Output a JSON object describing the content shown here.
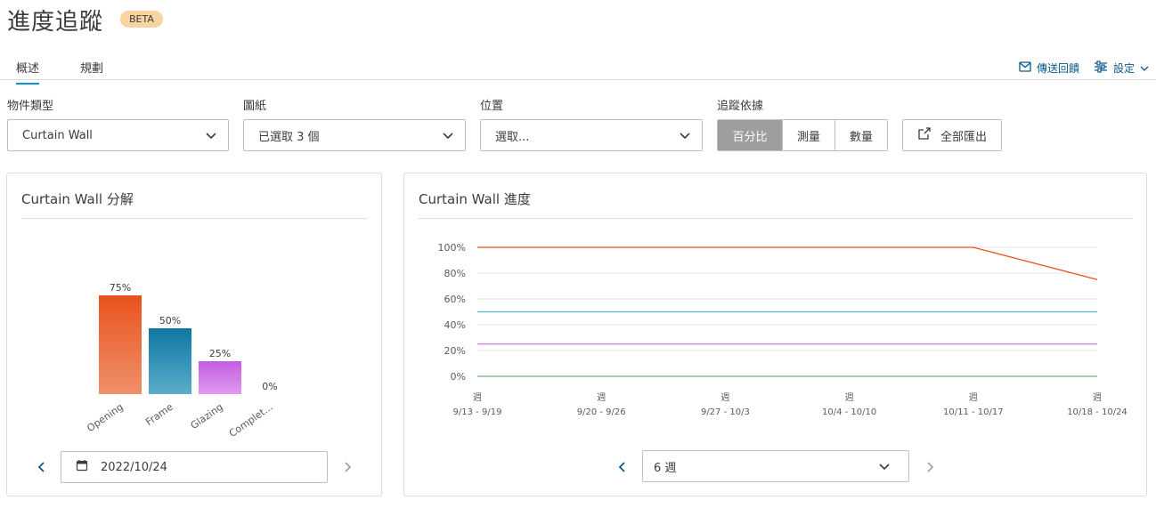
{
  "header": {
    "title": "進度追蹤",
    "badge": "BETA"
  },
  "tabs": [
    {
      "label": "概述",
      "active": true
    },
    {
      "label": "規劃",
      "active": false
    }
  ],
  "top_links": {
    "feedback": "傳送回饋",
    "settings": "設定"
  },
  "filters": {
    "object_type": {
      "label": "物件類型",
      "value": "Curtain Wall"
    },
    "drawings": {
      "label": "圖紙",
      "value": "已選取 3 個"
    },
    "location": {
      "label": "位置",
      "placeholder": "選取..."
    },
    "track_by": {
      "label": "追蹤依據",
      "options": [
        "百分比",
        "測量",
        "數量"
      ],
      "selected": "百分比"
    },
    "export_all": "全部匯出"
  },
  "breakdown_panel": {
    "title": "Curtain Wall 分解",
    "date": "2022/10/24"
  },
  "progress_panel": {
    "title": "Curtain Wall 進度",
    "weeks_select": "6 週"
  },
  "colors": {
    "accent": "#0696d7",
    "opening": "#e8531d",
    "frame": "#0f77a3",
    "glazing": "#c45de0",
    "line_open": "#e8531d",
    "line_frame": "#5aaec8",
    "line_glazing": "#cf7ae8",
    "line_complete": "#6fae7a"
  },
  "chart_data": [
    {
      "type": "bar",
      "categories": [
        "Opening",
        "Frame",
        "Glazing",
        "Complet..."
      ],
      "values": [
        75,
        50,
        25,
        0
      ],
      "data_labels": [
        "75%",
        "50%",
        "25%",
        "0%"
      ]
    },
    {
      "type": "line",
      "x": [
        "9/13 - 9/19",
        "9/20 - 9/26",
        "9/27 - 10/3",
        "10/4 - 10/10",
        "10/11 - 10/17",
        "10/18 - 10/24"
      ],
      "x_prefix": "週",
      "y_ticks": [
        "100%",
        "80%",
        "60%",
        "40%",
        "20%",
        "0%"
      ],
      "ylim": [
        0,
        100
      ],
      "grid": true,
      "series": [
        {
          "values": [
            100,
            100,
            100,
            100,
            100,
            75
          ],
          "color": "#e8531d"
        },
        {
          "values": [
            50,
            50,
            50,
            50,
            50,
            50
          ],
          "color": "#5aaec8"
        },
        {
          "values": [
            25,
            25,
            25,
            25,
            25,
            25
          ],
          "color": "#cf7ae8"
        },
        {
          "values": [
            0,
            0,
            0,
            0,
            0,
            0
          ],
          "color": "#6fae7a"
        }
      ]
    }
  ]
}
